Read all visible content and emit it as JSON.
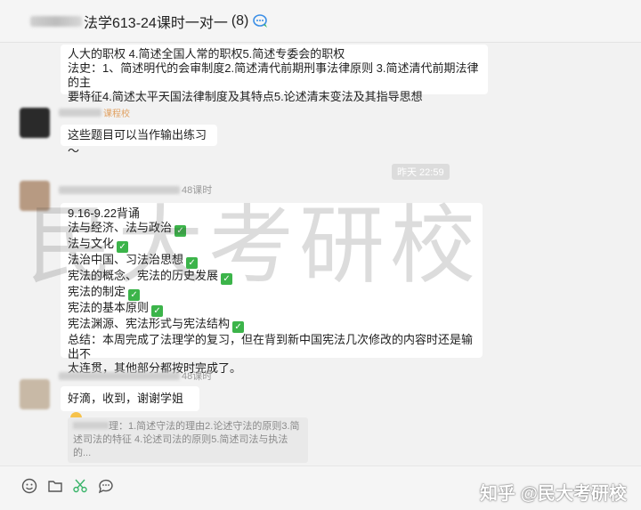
{
  "header": {
    "title": "法学613-24课时一对一",
    "count": "(8)"
  },
  "messages": {
    "m1": {
      "line1": "人大的职权 4.简述全国人常的职权5.简述专委会的职权",
      "line2": "法史：1、简述明代的会审制度2.简述清代前期刑事法律原则 3.简述清代前期法律的主",
      "line3": "要特征4.简述太平天国法律制度及其特点5.论述清末变法及其指导思想"
    },
    "m2": {
      "sender_suffix": "课程校",
      "text": "这些题目可以当作输出练习～"
    },
    "timestamp": "昨天 22:59",
    "m3": {
      "sender_suffix": "48课时",
      "lines": [
        "9.16-9.22背诵",
        "法与经济、法与政治",
        "法与文化",
        "法治中国、习法治思想",
        "宪法的概念、宪法的历史发展",
        "宪法的制定",
        "宪法的基本原则",
        "宪法渊源、宪法形式与宪法结构",
        "总结：本周完成了法理学的复习，但在背到新中国宪法几次修改的内容时还是输出不",
        "太连贯，其他部分都按时完成了。"
      ]
    },
    "m4": {
      "sender_suffix": "48课时",
      "text": "好滴，收到，谢谢学姐",
      "quote_line1": "理：1.简述守法的理由2.论述守法的原则3.简",
      "quote_line2": "述司法的特征 4.论述司法的原则5.简述司法与执法的..."
    }
  },
  "watermark": "民大考研校",
  "footer_watermark": "知乎 @民大考研校",
  "icons": [
    "emoji-icon",
    "folder-icon",
    "scissors-icon",
    "chat-bubble-icon"
  ]
}
